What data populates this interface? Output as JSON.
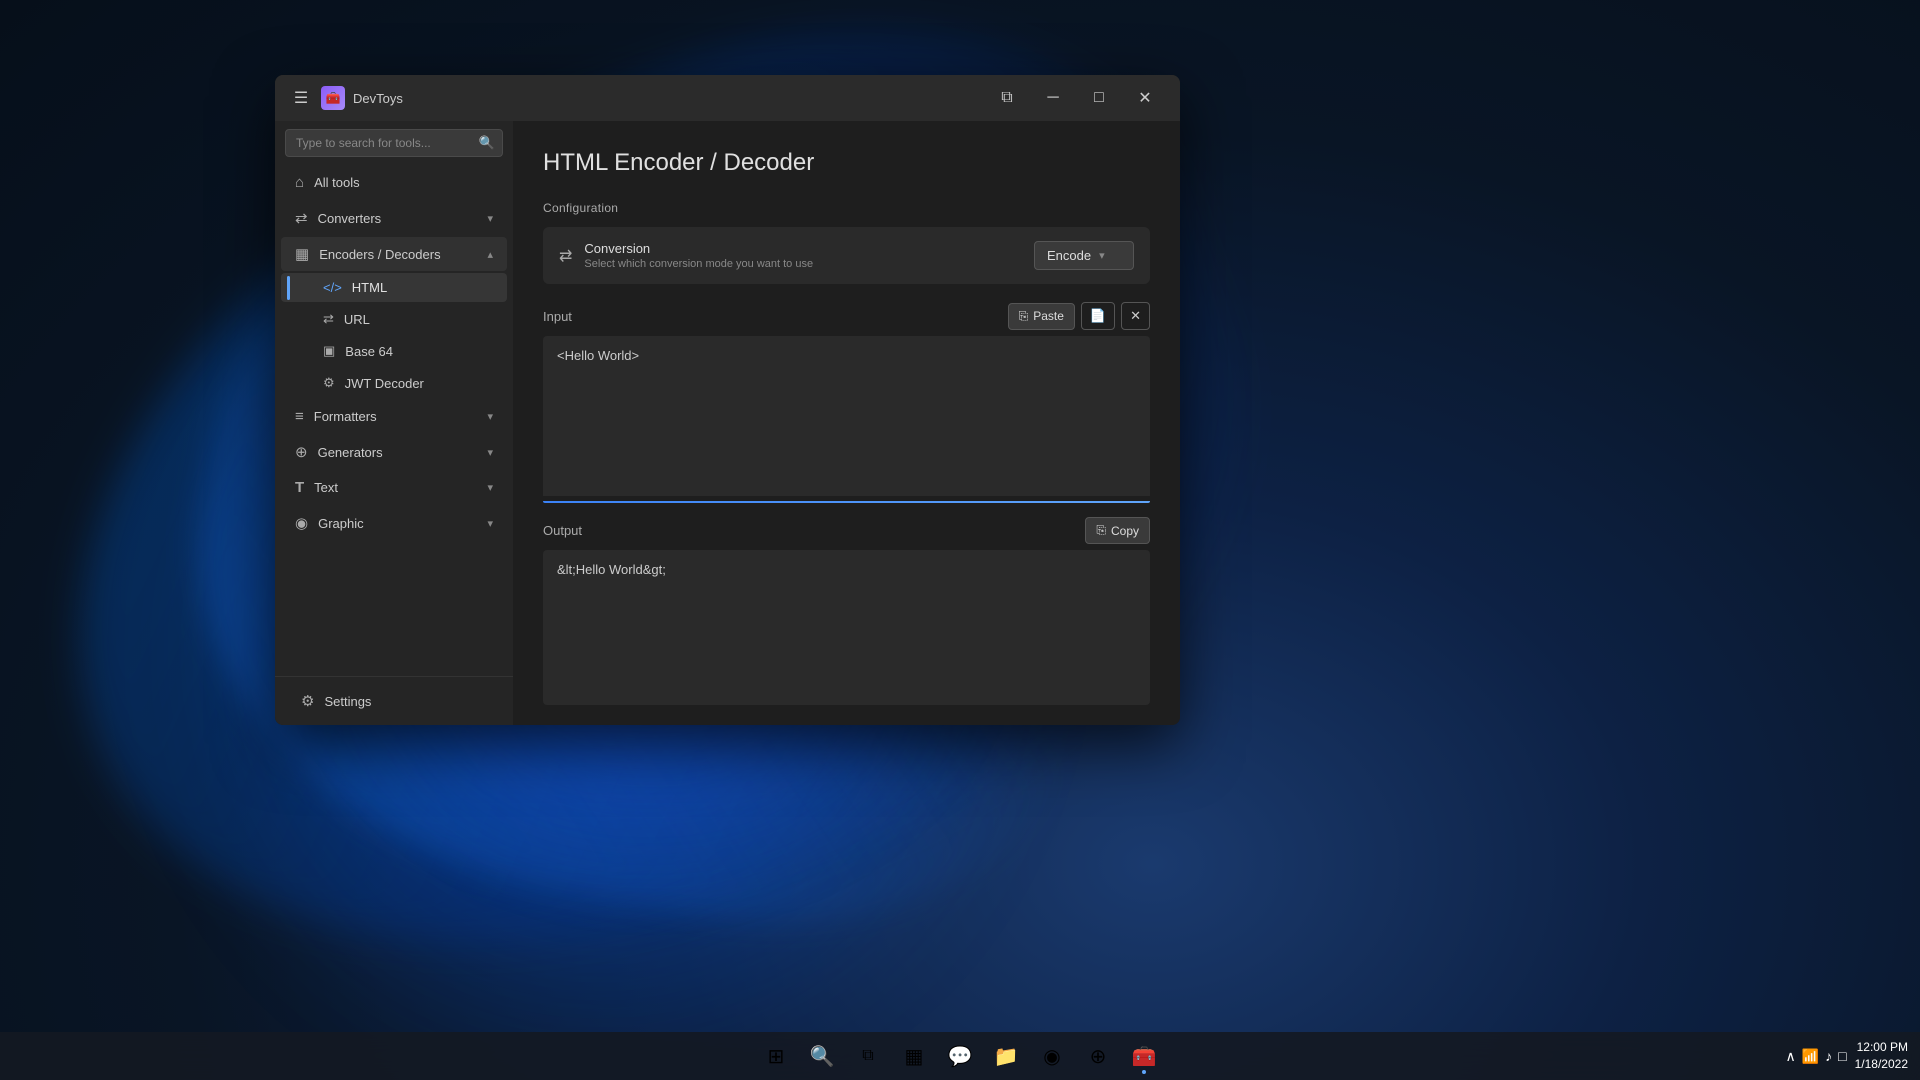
{
  "desktop": {
    "bg": "desktop-background"
  },
  "window": {
    "title": "DevToys",
    "logo_char": "🧰"
  },
  "titlebar": {
    "menu_icon": "☰",
    "title": "DevToys",
    "restore_icon": "⧉",
    "minimize_icon": "─",
    "maximize_icon": "□",
    "close_icon": "✕"
  },
  "sidebar": {
    "search_placeholder": "Type to search for tools...",
    "all_tools_label": "All tools",
    "items": [
      {
        "id": "all-tools",
        "label": "All tools",
        "icon": "⌂"
      },
      {
        "id": "converters",
        "label": "Converters",
        "icon": "⇄",
        "expandable": true,
        "expanded": false
      },
      {
        "id": "encoders-decoders",
        "label": "Encoders / Decoders",
        "icon": "▦",
        "expandable": true,
        "expanded": true
      },
      {
        "id": "html",
        "label": "HTML",
        "icon": "</>",
        "sub": true,
        "active": true
      },
      {
        "id": "url",
        "label": "URL",
        "icon": "⇄",
        "sub": true
      },
      {
        "id": "base64",
        "label": "Base 64",
        "icon": "▣",
        "sub": true
      },
      {
        "id": "jwt-decoder",
        "label": "JWT Decoder",
        "icon": "⚙",
        "sub": true
      },
      {
        "id": "formatters",
        "label": "Formatters",
        "icon": "≡",
        "expandable": true,
        "expanded": false
      },
      {
        "id": "generators",
        "label": "Generators",
        "icon": "⊕",
        "expandable": true,
        "expanded": false
      },
      {
        "id": "text",
        "label": "Text",
        "icon": "T",
        "expandable": true,
        "expanded": false
      },
      {
        "id": "graphic",
        "label": "Graphic",
        "icon": "◉",
        "expandable": true,
        "expanded": false
      }
    ],
    "settings_label": "Settings",
    "settings_icon": "⚙"
  },
  "main": {
    "title": "HTML Encoder / Decoder",
    "configuration": {
      "section_label": "Configuration",
      "conversion_title": "Conversion",
      "conversion_desc": "Select which conversion mode you want to use",
      "conversion_icon": "⇄",
      "dropdown_value": "Encode",
      "dropdown_chevron": "▾"
    },
    "input": {
      "label": "Input",
      "paste_label": "Paste",
      "paste_icon": "⎘",
      "file_icon": "📄",
      "clear_icon": "✕",
      "value": "<Hello World>"
    },
    "output": {
      "label": "Output",
      "copy_label": "Copy",
      "copy_icon": "⎘",
      "value": "&lt;Hello World&gt;"
    }
  },
  "taskbar": {
    "start_icon": "⊞",
    "search_icon": "🔍",
    "task_view_icon": "⧉",
    "widgets_icon": "▦",
    "chat_icon": "💬",
    "explorer_icon": "📁",
    "edge_icon": "◉",
    "store_icon": "⊕",
    "devtoys_icon": "🧰",
    "chevron_up": "∧",
    "time": "12:00 PM",
    "date": "1/18/2022",
    "sys_icons": [
      "∧",
      "□",
      "♪",
      "📶"
    ]
  }
}
